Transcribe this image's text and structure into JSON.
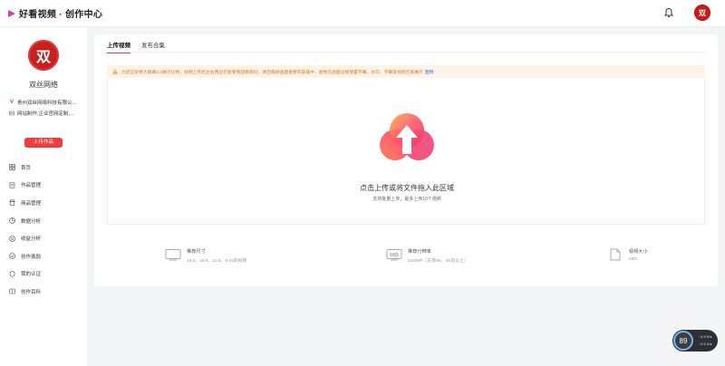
{
  "app": {
    "title": "好看视频 · 创作中心",
    "header_avatar_text": "双"
  },
  "profile": {
    "avatar_text": "双",
    "name": "双丝网络",
    "company": "贵州双丝网络科技有限公...",
    "certification": "网站制作,企业官网定制,..."
  },
  "sidebar": {
    "upload_label": "上传作品",
    "items": [
      {
        "label": "首页",
        "icon": "home-grid-icon"
      },
      {
        "label": "作品管理",
        "icon": "document-icon"
      },
      {
        "label": "商品管理",
        "icon": "shop-icon"
      },
      {
        "label": "数据分析",
        "icon": "chart-icon"
      },
      {
        "label": "收益分析",
        "icon": "coin-icon"
      },
      {
        "label": "创作激励",
        "icon": "badge-icon"
      },
      {
        "label": "我的认证",
        "icon": "shield-check-icon"
      },
      {
        "label": "创作百科",
        "icon": "book-icon"
      }
    ]
  },
  "tabs": [
    {
      "label": "上传视频",
      "active": true
    },
    {
      "label": "发布合集",
      "active": false
    }
  ],
  "notice": {
    "text": "为适应好看大屏幕3:2展示比例，视频上传后左右两边可能受到轻微裁切，请您确保画面重要内容居中，避免在画面边缘放置字幕、水印、字幕等视频元素展示",
    "link": "图例"
  },
  "dropzone": {
    "title": "点击上传或将文件拖入此区域",
    "subtitle": "支持批量上传，最多上传10个视频"
  },
  "specs": [
    {
      "label": "推荐尺寸",
      "value": "16:9、18:9、21:9、9:16的视频",
      "icon": "screen-icon"
    },
    {
      "label": "推荐分辨率",
      "value": "≥1080P（支持2K、4K及以上）",
      "icon": "hd-icon"
    },
    {
      "label": "视频大小",
      "value": "≤8G",
      "icon": "file-icon"
    }
  ],
  "widget": {
    "gauge": "89",
    "up": "0.9",
    "up_unit": "K/s",
    "down": "0.2",
    "down_unit": "K/s"
  },
  "colors": {
    "accent": "#f23b3b",
    "notice_bg": "#fdf3e8",
    "notice_text": "#d97a1a",
    "link": "#2f6fd8"
  }
}
